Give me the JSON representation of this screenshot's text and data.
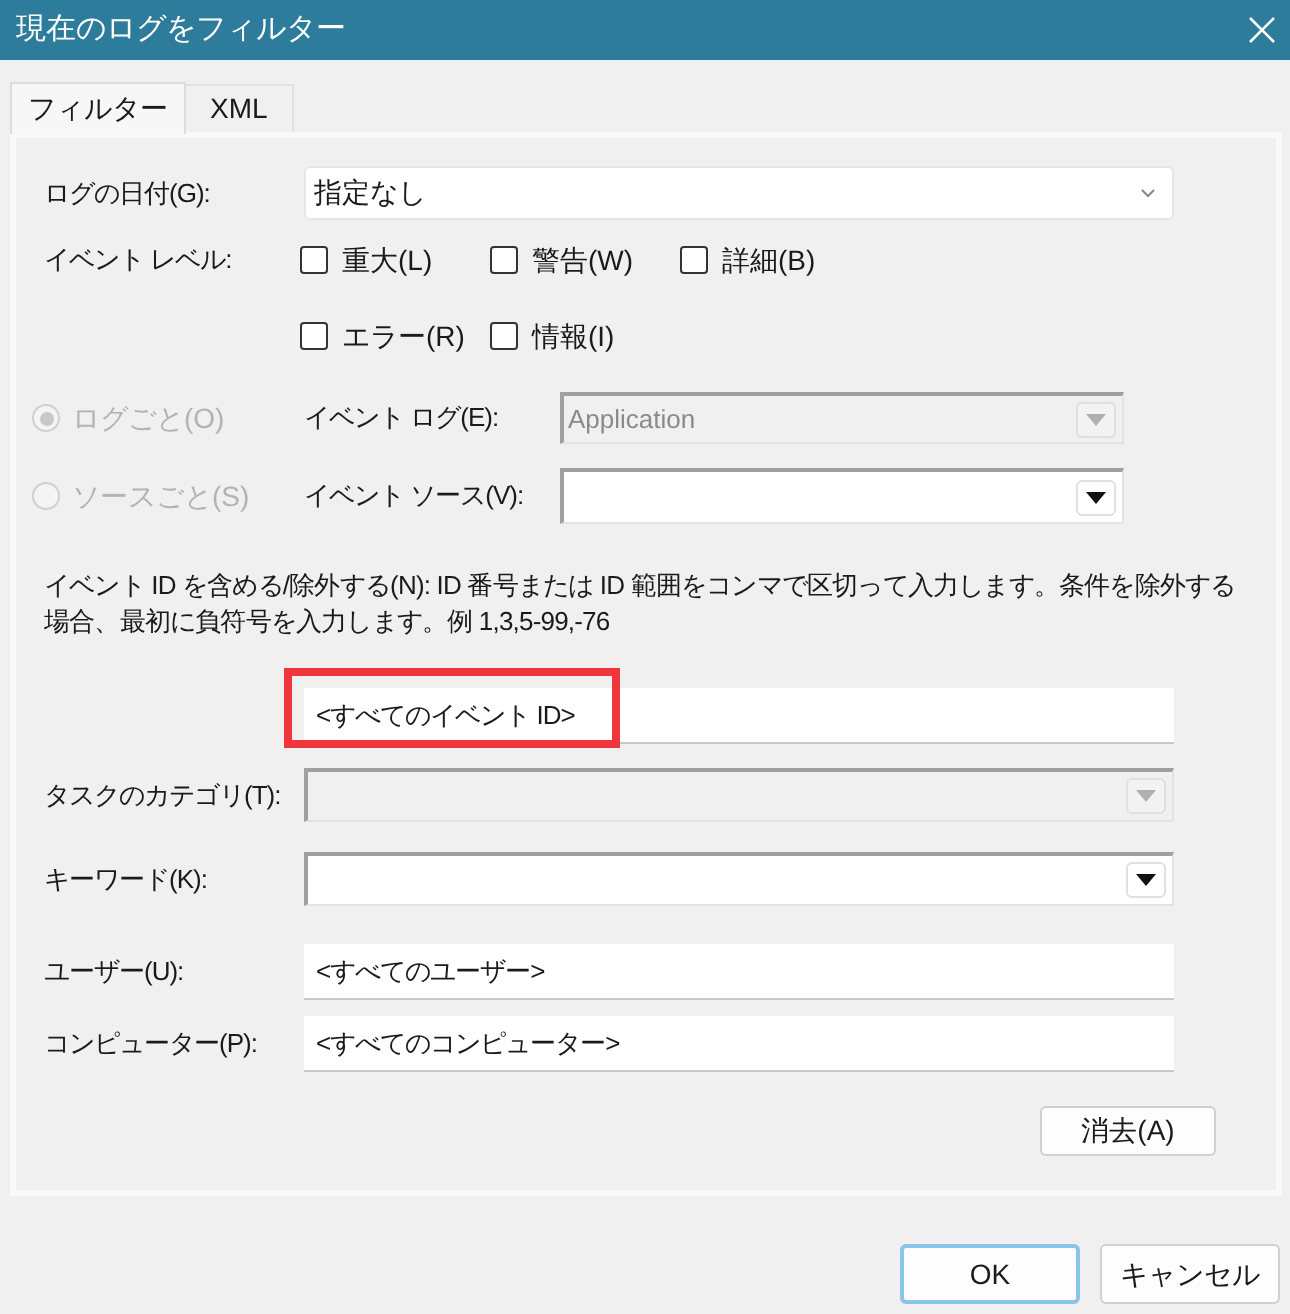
{
  "window": {
    "title": "現在のログをフィルター"
  },
  "tabs": [
    {
      "label": "フィルター",
      "selected": true
    },
    {
      "label": "XML",
      "selected": false
    }
  ],
  "log_date": {
    "label": "ログの日付(G):",
    "value": "指定なし"
  },
  "event_level": {
    "label": "イベント レベル:",
    "rows": [
      [
        {
          "label": "重大(L)",
          "checked": false
        },
        {
          "label": "警告(W)",
          "checked": false
        },
        {
          "label": "詳細(B)",
          "checked": false
        }
      ],
      [
        {
          "label": "エラー(R)",
          "checked": false
        },
        {
          "label": "情報(I)",
          "checked": false
        }
      ]
    ]
  },
  "scope": [
    {
      "radio": {
        "label": "ログごと(O)",
        "selected": true,
        "disabled": true
      },
      "field": {
        "label": "イベント ログ(E):",
        "value": "Application",
        "disabled": true
      }
    },
    {
      "radio": {
        "label": "ソースごと(S)",
        "selected": false,
        "disabled": true
      },
      "field": {
        "label": "イベント ソース(V):",
        "disabled": false
      }
    }
  ],
  "event_id": {
    "description": "イベント ID を含める/除外する(N): ID 番号または ID 範囲をコンマで区切って入力します。条件を除外する場合、最初に負符号を入力します。例 1,3,5-99,-76",
    "value": "<すべてのイベント ID>",
    "highlighted": true
  },
  "task_category": {
    "label": "タスクのカテゴリ(T):",
    "disabled": true
  },
  "keyword": {
    "label": "キーワード(K):",
    "disabled": false
  },
  "user": {
    "label": "ユーザー(U):",
    "value": "<すべてのユーザー>"
  },
  "computer": {
    "label": "コンピューター(P):",
    "value": "<すべてのコンピューター>"
  },
  "clear_button": {
    "label": "消去(A)"
  },
  "buttons": [
    {
      "label": "OK",
      "default": true
    },
    {
      "label": "キャンセル",
      "default": false
    }
  ]
}
